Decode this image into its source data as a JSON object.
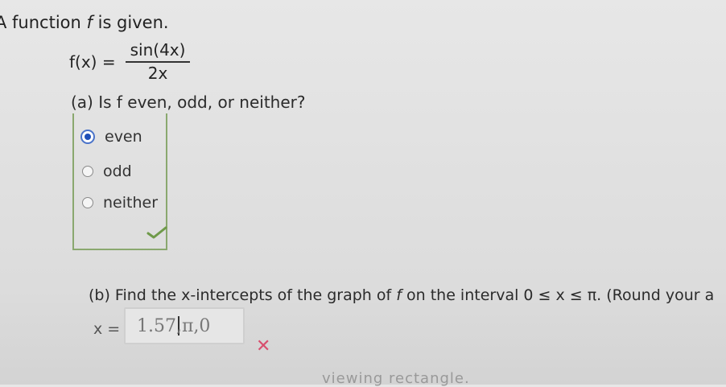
{
  "intro": {
    "prefix": "A function",
    "var": "f",
    "suffix": "is given."
  },
  "formula": {
    "lhs": "f(x) =",
    "numerator": "sin(4x)",
    "denominator": "2x"
  },
  "part_a": {
    "question": "(a) Is f even, odd, or neither?",
    "options": [
      {
        "label": "even",
        "selected": true
      },
      {
        "label": "odd",
        "selected": false
      },
      {
        "label": "neither",
        "selected": false
      }
    ],
    "status": "correct"
  },
  "part_b": {
    "question_prefix": "(b) Find the x-intercepts of the graph of",
    "var": "f",
    "question_suffix": "on the interval  0 ≤ x ≤ π.  (Round your a",
    "answer_label": "x =",
    "answer_before_cursor": "1.57",
    "answer_after_cursor": ",π,0",
    "status": "incorrect",
    "status_mark": "✕"
  },
  "footer_text": "viewing rectangle."
}
